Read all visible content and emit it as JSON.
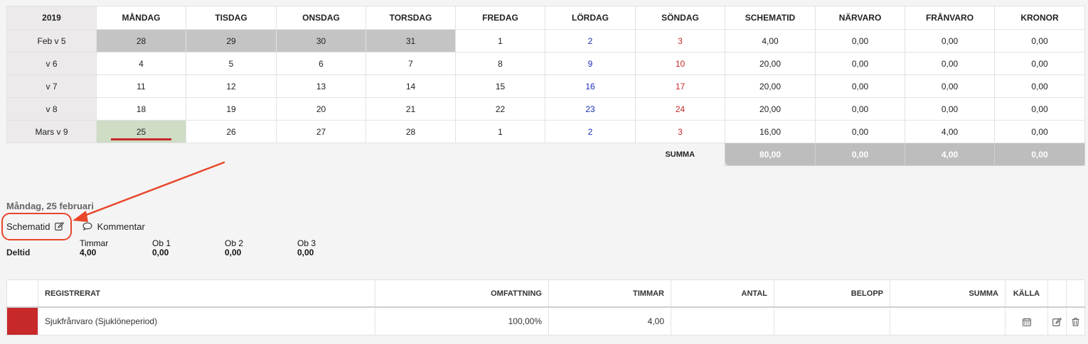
{
  "calendar": {
    "headers": [
      "2019",
      "MÅNDAG",
      "TISDAG",
      "ONSDAG",
      "TORSDAG",
      "FREDAG",
      "LÖRDAG",
      "SÖNDAG",
      "SCHEMATID",
      "NÄRVARO",
      "FRÅNVARO",
      "KRONOR"
    ],
    "rows": [
      {
        "week": "Feb v 5",
        "days": [
          "28",
          "29",
          "30",
          "31",
          "1",
          "2",
          "3"
        ],
        "schematid": "4,00",
        "narvaro": "0,00",
        "franvaro": "0,00",
        "kronor": "0,00"
      },
      {
        "week": "v 6",
        "days": [
          "4",
          "5",
          "6",
          "7",
          "8",
          "9",
          "10"
        ],
        "schematid": "20,00",
        "narvaro": "0,00",
        "franvaro": "0,00",
        "kronor": "0,00"
      },
      {
        "week": "v 7",
        "days": [
          "11",
          "12",
          "13",
          "14",
          "15",
          "16",
          "17"
        ],
        "schematid": "20,00",
        "narvaro": "0,00",
        "franvaro": "0,00",
        "kronor": "0,00"
      },
      {
        "week": "v 8",
        "days": [
          "18",
          "19",
          "20",
          "21",
          "22",
          "23",
          "24"
        ],
        "schematid": "20,00",
        "narvaro": "0,00",
        "franvaro": "0,00",
        "kronor": "0,00"
      },
      {
        "week": "Mars v 9",
        "days": [
          "25",
          "26",
          "27",
          "28",
          "1",
          "2",
          "3"
        ],
        "schematid": "16,00",
        "narvaro": "0,00",
        "franvaro": "4,00",
        "kronor": "0,00"
      }
    ],
    "summa": {
      "label": "SUMMA",
      "schematid": "80,00",
      "narvaro": "0,00",
      "franvaro": "4,00",
      "kronor": "0,00"
    }
  },
  "day": {
    "title": "Måndag, 25 februari",
    "schematid_link": "Schematid",
    "kommentar_link": "Kommentar",
    "type_label": "Deltid",
    "stats": [
      {
        "label": "Timmar",
        "value": "4,00"
      },
      {
        "label": "Ob 1",
        "value": "0,00"
      },
      {
        "label": "Ob 2",
        "value": "0,00"
      },
      {
        "label": "Ob 3",
        "value": "0,00"
      }
    ]
  },
  "registrations": {
    "headers": {
      "registrerat": "REGISTRERAT",
      "omfattning": "OMFATTNING",
      "timmar": "TIMMAR",
      "antal": "ANTAL",
      "belopp": "BELOPP",
      "summa": "SUMMA",
      "kalla": "KÄLLA"
    },
    "rows": [
      {
        "registrerat": "Sjukfrånvaro (Sjuklöneperiod)",
        "omfattning": "100,00%",
        "timmar": "4,00",
        "antal": "",
        "belopp": "",
        "summa": ""
      }
    ]
  },
  "colors": {
    "accent": "#c7282a",
    "annotation": "#e8462a",
    "saturday": "#1b2db6",
    "sunday": "#c7282a"
  }
}
